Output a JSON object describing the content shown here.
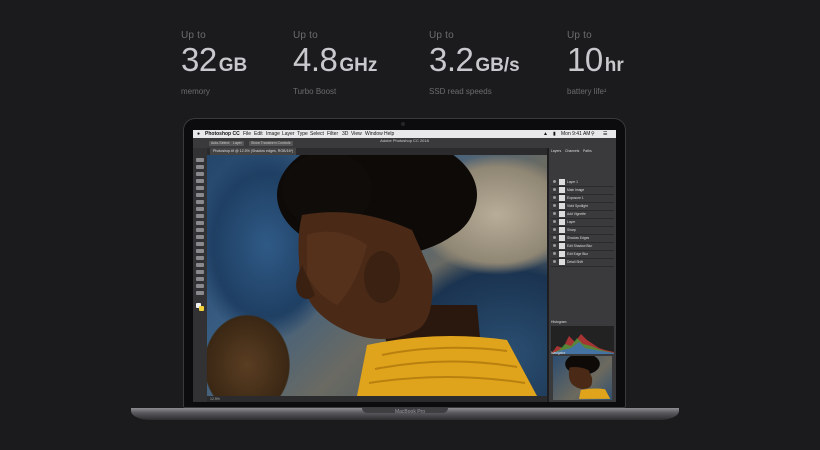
{
  "specs": [
    {
      "prefix": "Up to",
      "value": "32",
      "unit": "GB",
      "label": "memory"
    },
    {
      "prefix": "Up to",
      "value": "4.8",
      "unit": "GHz",
      "label": "Turbo Boost"
    },
    {
      "prefix": "Up to",
      "value": "3.2",
      "unit": "GB/s",
      "label": "SSD read speeds"
    },
    {
      "prefix": "Up to",
      "value": "10",
      "unit": "hr",
      "label": "battery life¹"
    }
  ],
  "laptop": {
    "model_label": "MacBook Pro",
    "menubar": {
      "app": "Photoshop CC",
      "items": [
        "File",
        "Edit",
        "Image",
        "Layer",
        "Type",
        "Select",
        "Filter",
        "3D",
        "View",
        "Window",
        "Help"
      ],
      "clock": "Mon 9:41 AM"
    },
    "photoshop": {
      "window_title": "Adobe Photoshop CC 2018",
      "document_tab": "Photoshop.tif @ 12.5% (Shadow edges, RGB/16*)",
      "options": [
        "Auto-Select:",
        "Layer",
        "Show Transform Controls"
      ],
      "status_zoom": "12.5%",
      "panel_tabs": [
        "Layers",
        "Channels",
        "Paths"
      ],
      "layers": [
        "Layer 1",
        "Main Image",
        "Exposure 1",
        "Vivid Spotlight",
        "Add Vignette",
        "Layer",
        "Sharp",
        "Shadow Edges",
        "Edit Shadow Blur",
        "Edit Edge Blur",
        "Detail Shift"
      ],
      "histogram_tab": "Histogram",
      "navigator_tab": "Navigator"
    }
  }
}
